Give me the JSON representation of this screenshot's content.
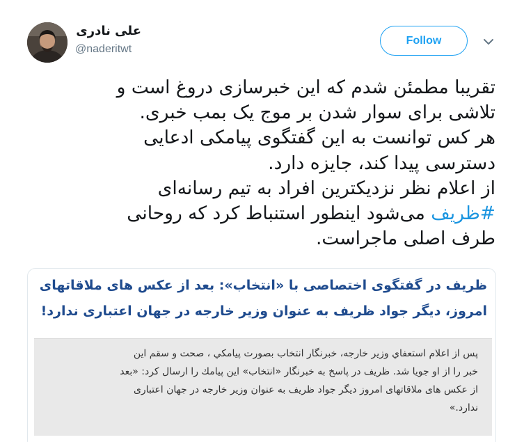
{
  "tweet": {
    "author_name": "علی نادری",
    "author_handle": "@naderitwt",
    "follow_label": "Follow",
    "text_lines": [
      "تقریبا مطمئن شدم که این خبرسازی دروغ است و",
      "تلاشی برای سوار شدن بر موج یک بمب خبری.",
      "هر کس توانست به این گفتگوی پیامکی ادعایی",
      "دسترسی پیدا کند، جایزه دارد.",
      "از اعلام نظر نزدیکترین افراد به تیم رسانه‌ای",
      "می‌شود اینطور استنباط کرد که روحانی",
      "طرف اصلی ماجراست."
    ],
    "hashtag": "#ظریف"
  },
  "card": {
    "headline_lines": [
      "ظریف در گفتگوی اختصاصی با «انتخاب»: بعد از عکس های ملاقاتهای",
      "امروز، دیگر جواد ظریف به عنوان وزیر خارجه در جهان اعتباری ندارد!"
    ],
    "body_lines": [
      "پس از اعلام استعفاي وزير خارجه، خبرنگار انتخاب بصورت پيامكي ، صحت و سقم اين",
      "خبر را از او جويا شد. ظریف در پاسخ به خبرنگار «انتخاب» اين پيامك را ارسال كرد: «بعد",
      "از عکس های ملاقاتهای امروز دیگر جواد ظریف به عنوان وزیر خارجه در جهان اعتباری",
      "ندارد.»"
    ]
  },
  "colors": {
    "accent": "#1da1f2",
    "hashtag": "#1b95e0",
    "headline": "#1f4b8e"
  },
  "icons": {
    "more": "chevron-down-icon",
    "avatar": "profile-photo"
  }
}
